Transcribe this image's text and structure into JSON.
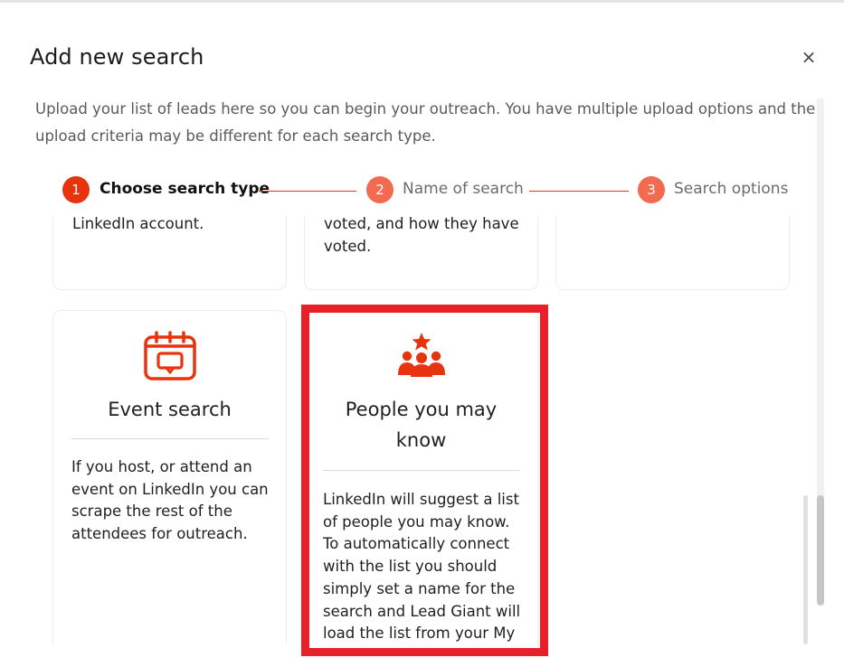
{
  "modal": {
    "title": "Add new search",
    "close_symbol": "×",
    "description": "Upload your list of leads here so you can begin your outreach. You have multiple upload options and the upload criteria may be different for each search type."
  },
  "steps": [
    {
      "number": "1",
      "label": "Choose search type",
      "active": true
    },
    {
      "number": "2",
      "label": "Name of search",
      "active": false
    },
    {
      "number": "3",
      "label": "Search options",
      "active": false
    }
  ],
  "colors": {
    "accent": "#e8330f",
    "step_inactive": "#f26a4f",
    "highlight": "#e8202a"
  },
  "cards_top_row": [
    {
      "text_lines": [
        "LinkedIn account."
      ]
    },
    {
      "text_lines": [
        "voted, and how they have",
        "voted."
      ]
    },
    {
      "text_lines": []
    }
  ],
  "cards": [
    {
      "icon": "calendar-icon",
      "title": "Event search",
      "description_lines": [
        "If you host, or attend an",
        "event on LinkedIn you can",
        "scrape the rest of the",
        "attendees for outreach."
      ]
    },
    {
      "icon": "people-star-icon",
      "title_lines": [
        "People you may",
        "know"
      ],
      "description_lines": [
        "LinkedIn will suggest a list",
        "of people you may know.",
        "To automatically connect",
        "with the list you should",
        "simply set a name for the",
        "search and Lead Giant will",
        "load the list from your My"
      ]
    }
  ]
}
